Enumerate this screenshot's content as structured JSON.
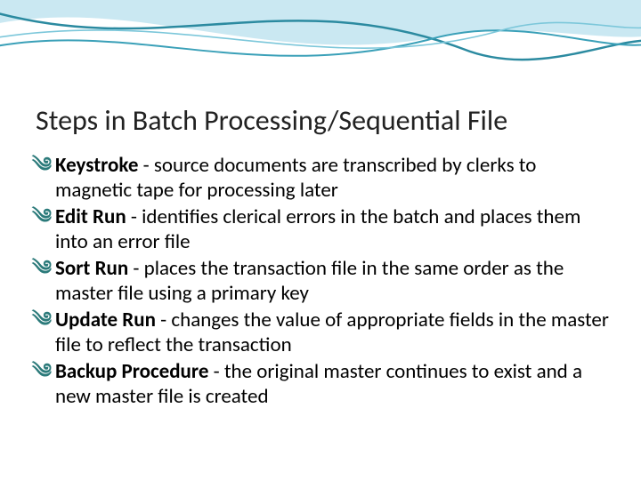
{
  "title": "Steps in Batch Processing/Sequential File",
  "bullets": [
    {
      "term": "Keystroke",
      "desc": " - source documents are transcribed by clerks to magnetic tape for processing later"
    },
    {
      "term": "Edit Run",
      "desc": " - identifies clerical errors in the batch and places them into an error file"
    },
    {
      "term": "Sort Run",
      "desc": " - places the transaction file in the same order as the master file using a primary key"
    },
    {
      "term": "Update Run",
      "desc": " - changes the value of appropriate fields in the master file to reflect the transaction"
    },
    {
      "term": "Backup Procedure",
      "desc": " - the original master continues to exist and a new master file is created"
    }
  ],
  "bullet_glyph": "༄"
}
